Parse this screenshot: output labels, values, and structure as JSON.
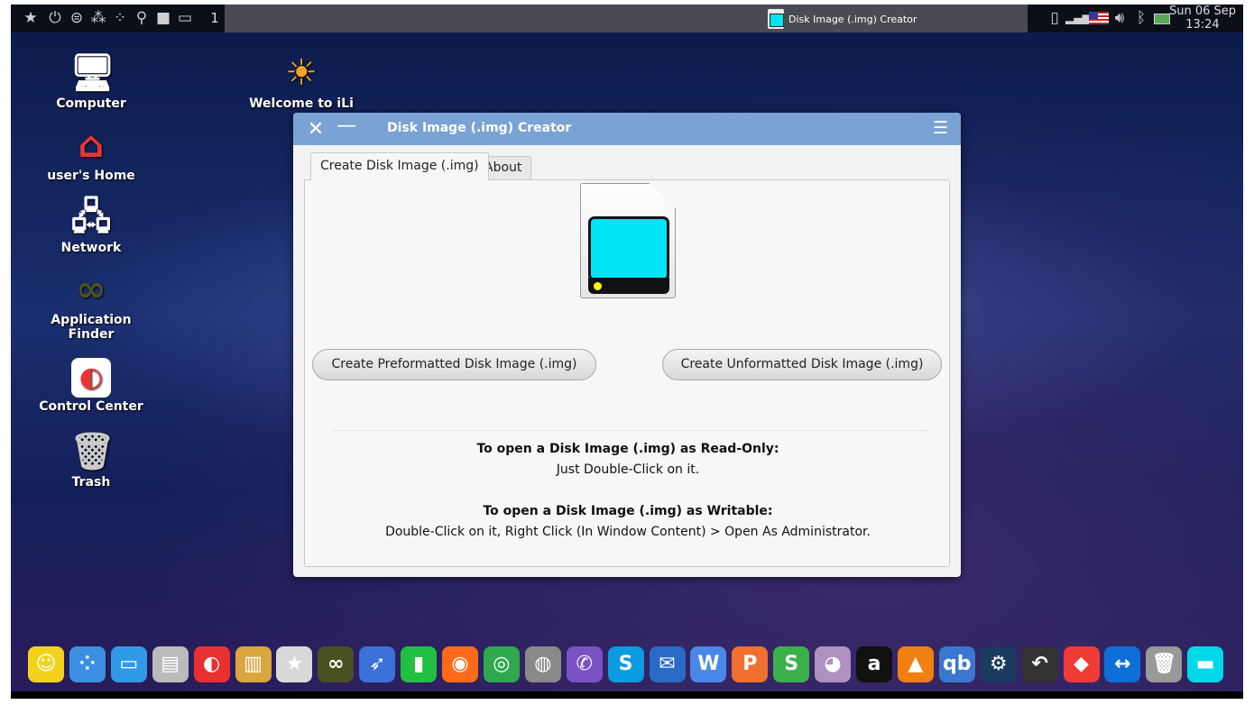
{
  "topbar": {
    "workspace": "1",
    "task_title": "Disk Image (.img) Creator",
    "clock_date": "Sun 06 Sep",
    "clock_time": "13:24",
    "launchers": [
      "star-icon",
      "power-icon",
      "toggle-icon",
      "binoculars-icon",
      "apps-icon",
      "search-icon",
      "folder-icon",
      "desktop-icon"
    ],
    "tray": [
      "clipboard-icon",
      "signal-icon",
      "us-flag-icon",
      "volume-icon",
      "bluetooth-icon",
      "battery-icon"
    ]
  },
  "desktop": {
    "icons": [
      {
        "label": "Computer",
        "icon": "computer-icon"
      },
      {
        "label": "user's Home",
        "icon": "home-icon"
      },
      {
        "label": "Network",
        "icon": "network-icon"
      },
      {
        "label": "Application Finder",
        "icon": "binoculars-icon"
      },
      {
        "label": "Control Center",
        "icon": "toggle-icon"
      },
      {
        "label": "Trash",
        "icon": "trash-icon"
      },
      {
        "label": "Welcome to iLi",
        "icon": "sun-icon"
      }
    ]
  },
  "window": {
    "title": "Disk Image (.img) Creator",
    "tabs": [
      {
        "label": "Create Disk Image (.img)",
        "active": true
      },
      {
        "label": "About",
        "active": false
      }
    ],
    "buttons": {
      "preformatted": "Create Preformatted Disk Image (.img)",
      "unformatted": "Create Unformatted Disk Image (.img)"
    },
    "readonly_heading": "To open a Disk Image (.img) as Read-Only:",
    "readonly_text": "Just Double-Click on it.",
    "writable_heading": "To open a Disk Image (.img) as Writable:",
    "writable_text": "Double-Click on it, Right Click (In Window Content) > Open As Administrator."
  },
  "colors": {
    "titlebar": "#7aa2d2",
    "disk_screen": "#00e5f5"
  },
  "dock": [
    {
      "icon": "star-smile-icon",
      "glyph": "☺",
      "color": "#f2d21b"
    },
    {
      "icon": "dots-icon",
      "glyph": "⁘",
      "color": "#3b8fe0"
    },
    {
      "icon": "window-icon",
      "glyph": "▭",
      "color": "#2f9ae8"
    },
    {
      "icon": "file-cabinet-icon",
      "glyph": "▤",
      "color": "#bbbbbb"
    },
    {
      "icon": "control-center-icon",
      "glyph": "◐",
      "color": "#e83030"
    },
    {
      "icon": "color-palette-icon",
      "glyph": "▥",
      "color": "#d9a640"
    },
    {
      "icon": "store-bag-icon",
      "glyph": "★",
      "color": "#d8d8d8"
    },
    {
      "icon": "binoculars-icon",
      "glyph": "∞",
      "color": "#4a5020"
    },
    {
      "icon": "rocket-icon",
      "glyph": "➶",
      "color": "#3a70d8"
    },
    {
      "icon": "pipe-icon",
      "glyph": "▮",
      "color": "#22c040"
    },
    {
      "icon": "firefox-icon",
      "glyph": "◉",
      "color": "#ff6a1a"
    },
    {
      "icon": "chrome-icon",
      "glyph": "◎",
      "color": "#2fa84f"
    },
    {
      "icon": "google-earth-pro-icon",
      "glyph": "◍",
      "color": "#888888"
    },
    {
      "icon": "viber-icon",
      "glyph": "✆",
      "color": "#7b51c4"
    },
    {
      "icon": "skype-icon",
      "glyph": "S",
      "color": "#0a9be0"
    },
    {
      "icon": "thunderbird-icon",
      "glyph": "✉",
      "color": "#2a6bc8"
    },
    {
      "icon": "wps-writer-icon",
      "glyph": "W",
      "color": "#4a88e8"
    },
    {
      "icon": "wps-presentation-icon",
      "glyph": "P",
      "color": "#f07030"
    },
    {
      "icon": "wps-spreadsheet-icon",
      "glyph": "S",
      "color": "#3cb04a"
    },
    {
      "icon": "webcam-icon",
      "glyph": "◕",
      "color": "#b090c0"
    },
    {
      "icon": "anydesk-a-icon",
      "glyph": "a",
      "color": "#111111"
    },
    {
      "icon": "vlc-icon",
      "glyph": "▲",
      "color": "#f08010"
    },
    {
      "icon": "qbittorrent-icon",
      "glyph": "qb",
      "color": "#3a78d0"
    },
    {
      "icon": "steam-icon",
      "glyph": "⚙",
      "color": "#1a3a60"
    },
    {
      "icon": "restore-icon",
      "glyph": "↶",
      "color": "#333333"
    },
    {
      "icon": "anydesk-icon",
      "glyph": "◆",
      "color": "#ef3b36"
    },
    {
      "icon": "teamviewer-icon",
      "glyph": "↔",
      "color": "#0e6fd8"
    },
    {
      "icon": "trash-icon",
      "glyph": "🗑",
      "color": "#999999"
    },
    {
      "icon": "disk-image-icon",
      "glyph": "▬",
      "color": "#00d8ea"
    }
  ]
}
